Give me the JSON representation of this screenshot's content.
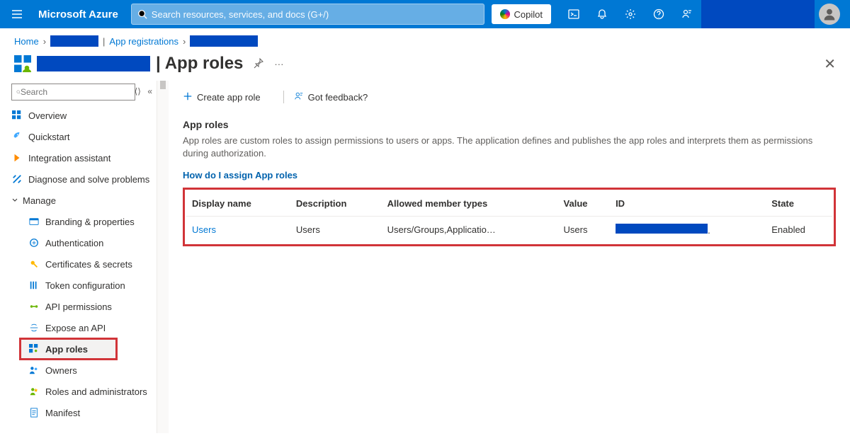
{
  "topbar": {
    "brand": "Microsoft Azure",
    "search_placeholder": "Search resources, services, and docs (G+/)",
    "copilot_label": "Copilot"
  },
  "breadcrumb": {
    "home": "Home",
    "app_reg": "App registrations"
  },
  "title": {
    "separator": "|",
    "page": "App roles"
  },
  "sidebar": {
    "search_placeholder": "Search",
    "overview": "Overview",
    "quickstart": "Quickstart",
    "integration": "Integration assistant",
    "diagnose": "Diagnose and solve problems",
    "manage_head": "Manage",
    "branding": "Branding & properties",
    "auth": "Authentication",
    "certs": "Certificates & secrets",
    "token": "Token configuration",
    "api_perm": "API permissions",
    "expose": "Expose an API",
    "app_roles": "App roles",
    "owners": "Owners",
    "roles_admin": "Roles and administrators",
    "manifest": "Manifest"
  },
  "commands": {
    "create": "Create app role",
    "feedback": "Got feedback?"
  },
  "section": {
    "heading": "App roles",
    "desc": "App roles are custom roles to assign permissions to users or apps. The application defines and publishes the app roles and interprets them as permissions during authorization.",
    "link": "How do I assign App roles"
  },
  "table": {
    "cols": {
      "display": "Display name",
      "desc": "Description",
      "allowed": "Allowed member types",
      "value": "Value",
      "id": "ID",
      "state": "State"
    },
    "row": {
      "display": "Users",
      "desc": "Users",
      "allowed": "Users/Groups,Applicatio…",
      "value": "Users",
      "state": "Enabled"
    }
  }
}
